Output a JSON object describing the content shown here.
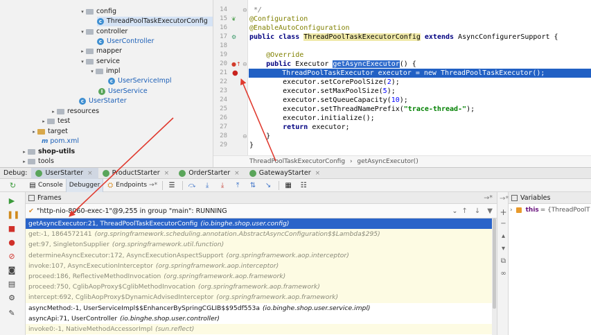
{
  "tree": {
    "items": [
      {
        "label": "config",
        "kind": "folder",
        "arrow": "▾"
      },
      {
        "label": "ThreadPoolTaskExecutorConfig",
        "kind": "class",
        "selected": true
      },
      {
        "label": "controller",
        "kind": "folder",
        "arrow": "▾"
      },
      {
        "label": "UserController",
        "kind": "class"
      },
      {
        "label": "mapper",
        "kind": "folder",
        "arrow": "▸"
      },
      {
        "label": "service",
        "kind": "folder",
        "arrow": "▾"
      },
      {
        "label": "impl",
        "kind": "folder",
        "arrow": "▾"
      },
      {
        "label": "UserServiceImpl",
        "kind": "class"
      },
      {
        "label": "UserService",
        "kind": "interface"
      },
      {
        "label": "UserStarter",
        "kind": "class"
      },
      {
        "label": "resources",
        "kind": "folder",
        "arrow": "▸"
      },
      {
        "label": "test",
        "kind": "folder",
        "arrow": "▸"
      },
      {
        "label": "target",
        "kind": "folder-yellow",
        "arrow": "▸"
      },
      {
        "label": "pom.xml",
        "kind": "maven"
      },
      {
        "label": "shop-utils",
        "kind": "folder",
        "arrow": "▸",
        "bold": true
      },
      {
        "label": "tools",
        "kind": "folder",
        "arrow": "▸"
      }
    ]
  },
  "editor": {
    "line_numbers": [
      "14",
      "15",
      "16",
      "17",
      "18",
      "19",
      "20",
      "21",
      "22",
      "23",
      "24",
      "25",
      "26",
      "27",
      "28",
      "29"
    ],
    "lines": {
      "l14": " */",
      "l15": "@Configuration",
      "l16": "@EnableAutoConfiguration",
      "l17_kw": "public class ",
      "l17_cls": "ThreadPoolTaskExecutorConfig",
      "l17_ext": " extends ",
      "l17_rest": "AsyncConfigurerSupport {",
      "l19": "    @Override",
      "l20_kw": "    public ",
      "l20_type": "Executor ",
      "l20_fn": "getAsyncExecutor",
      "l20_rest": "() {",
      "l21": "        ThreadPoolTaskExecutor executor = new ThreadPoolTaskExecutor();",
      "l22_a": "        executor.setCorePoolSize(",
      "l22_n": "2",
      "l23_a": "        executor.setMaxPoolSize(",
      "l23_n": "5",
      "l24_a": "        executor.setQueueCapacity(",
      "l24_n": "10",
      "l25_a": "        executor.setThreadNamePrefix(",
      "l25_s": "\"trace-thread-\"",
      "l26": "        executor.initialize();",
      "l27_kw": "        return ",
      "l27_rest": "executor;",
      "l28": "    }",
      "l29": "}",
      "close": ");",
      "close2": ");"
    },
    "breadcrumb": {
      "cls": "ThreadPoolTaskExecutorConfig",
      "sep": "›",
      "method": "getAsyncExecutor()"
    }
  },
  "debug_tabs": {
    "label": "Debug:",
    "tabs": [
      {
        "label": "UserStarter",
        "close": "×",
        "active": true
      },
      {
        "label": "ProductStarter",
        "close": "×"
      },
      {
        "label": "OrderStarter",
        "close": "×"
      },
      {
        "label": "GatewayStarter",
        "close": "×"
      }
    ]
  },
  "toolbar": {
    "console": "Console",
    "debugger": "Debugger",
    "endpoints": "Endpoints"
  },
  "frames": {
    "title": "Frames",
    "thread": "\"http-nio-8060-exec-1\"@9,255 in group \"main\": RUNNING",
    "rows": [
      {
        "method": "getAsyncExecutor:21, ThreadPoolTaskExecutorConfig",
        "pkg": "(io.binghe.shop.user.config)",
        "style": "cur"
      },
      {
        "method": "get:-1, 1864572141",
        "pkg": "(org.springframework.scheduling.annotation.AbstractAsyncConfiguration$$Lambda$295)",
        "style": "lib"
      },
      {
        "method": "get:97, SingletonSupplier",
        "pkg": "(org.springframework.util.function)",
        "style": "lib"
      },
      {
        "method": "determineAsyncExecutor:172, AsyncExecutionAspectSupport",
        "pkg": "(org.springframework.aop.interceptor)",
        "style": "lib"
      },
      {
        "method": "invoke:107, AsyncExecutionInterceptor",
        "pkg": "(org.springframework.aop.interceptor)",
        "style": "lib"
      },
      {
        "method": "proceed:186, ReflectiveMethodInvocation",
        "pkg": "(org.springframework.aop.framework)",
        "style": "lib"
      },
      {
        "method": "proceed:750, CglibAopProxy$CglibMethodInvocation",
        "pkg": "(org.springframework.aop.framework)",
        "style": "lib"
      },
      {
        "method": "intercept:692, CglibAopProxy$DynamicAdvisedInterceptor",
        "pkg": "(org.springframework.aop.framework)",
        "style": "lib"
      },
      {
        "method": "asyncMethod:-1, UserServiceImpl$$EnhancerBySpringCGLIB$$95df553a",
        "pkg": "(io.binghe.shop.user.service.impl)",
        "style": "user"
      },
      {
        "method": "asyncApi:71, UserController",
        "pkg": "(io.binghe.shop.user.controller)",
        "style": "user"
      },
      {
        "method": "invoke0:-1, NativeMethodAccessorImpl",
        "pkg": "(sun.reflect)",
        "style": "lib"
      }
    ]
  },
  "variables": {
    "title": "Variables",
    "row_name": "this",
    "row_value": "= {ThreadPoolT"
  },
  "colors": {
    "selection": "#2a64c9",
    "arrow": "#e03a2f",
    "lib_bg": "#fdfbe3"
  }
}
